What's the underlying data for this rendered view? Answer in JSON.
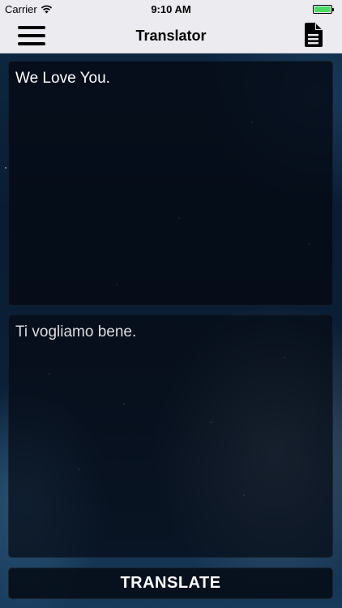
{
  "status_bar": {
    "carrier": "Carrier",
    "time": "9:10 AM",
    "battery_color": "#4cd964"
  },
  "nav": {
    "title": "Translator",
    "left_icon": "hamburger-menu-icon",
    "right_icon": "document-icon"
  },
  "input": {
    "text": "We Love You."
  },
  "output": {
    "text": "Ti vogliamo bene."
  },
  "actions": {
    "translate_label": "TRANSLATE"
  }
}
